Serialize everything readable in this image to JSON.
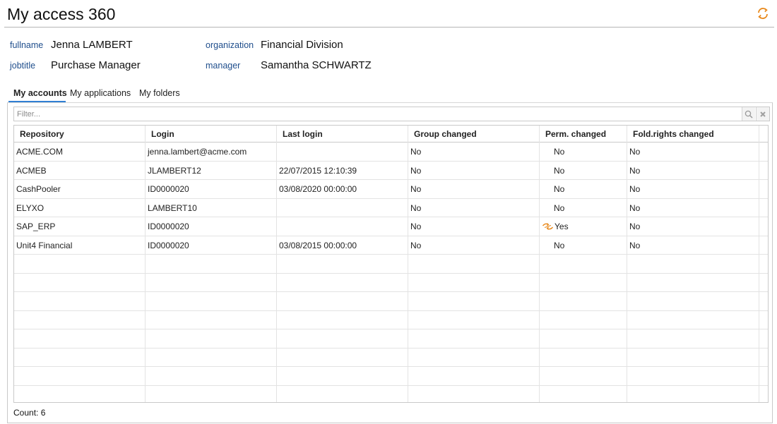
{
  "page": {
    "title": "My access 360",
    "refresh_icon": "refresh-icon",
    "accent": "#e8881a"
  },
  "identity": {
    "fullname_label": "fullname",
    "fullname": "Jenna LAMBERT",
    "jobtitle_label": "jobtitle",
    "jobtitle": "Purchase Manager",
    "organization_label": "organization",
    "organization": "Financial Division",
    "manager_label": "manager",
    "manager": "Samantha SCHWARTZ"
  },
  "tabs": [
    {
      "label": "My accounts",
      "active": true
    },
    {
      "label": "My applications",
      "active": false
    },
    {
      "label": "My folders",
      "active": false
    }
  ],
  "filter": {
    "placeholder": "Filter...",
    "search_icon": "search-icon",
    "clear_icon": "clear-icon"
  },
  "table": {
    "columns": [
      "Repository",
      "Login",
      "Last login",
      "Group changed",
      "Perm. changed",
      "Fold.rights changed"
    ],
    "rows": [
      {
        "repository": "ACME.COM",
        "login": "jenna.lambert@acme.com",
        "last_login": "",
        "group_changed": "No",
        "perm_changed": "No",
        "fold_changed": "No",
        "perm_flag": false
      },
      {
        "repository": "ACMEB",
        "login": "JLAMBERT12",
        "last_login": "22/07/2015 12:10:39",
        "group_changed": "No",
        "perm_changed": "No",
        "fold_changed": "No",
        "perm_flag": false
      },
      {
        "repository": "CashPooler",
        "login": "ID0000020",
        "last_login": "03/08/2020 00:00:00",
        "group_changed": "No",
        "perm_changed": "No",
        "fold_changed": "No",
        "perm_flag": false
      },
      {
        "repository": "ELYXO",
        "login": "LAMBERT10",
        "last_login": "",
        "group_changed": "No",
        "perm_changed": "No",
        "fold_changed": "No",
        "perm_flag": false
      },
      {
        "repository": "SAP_ERP",
        "login": "ID0000020",
        "last_login": "",
        "group_changed": "No",
        "perm_changed": "Yes",
        "fold_changed": "No",
        "perm_flag": true
      },
      {
        "repository": "Unit4 Financial",
        "login": "ID0000020",
        "last_login": "03/08/2015 00:00:00",
        "group_changed": "No",
        "perm_changed": "No",
        "fold_changed": "No",
        "perm_flag": false
      }
    ],
    "changed_icon": "changed-icon"
  },
  "footer": {
    "count": "Count: 6"
  }
}
